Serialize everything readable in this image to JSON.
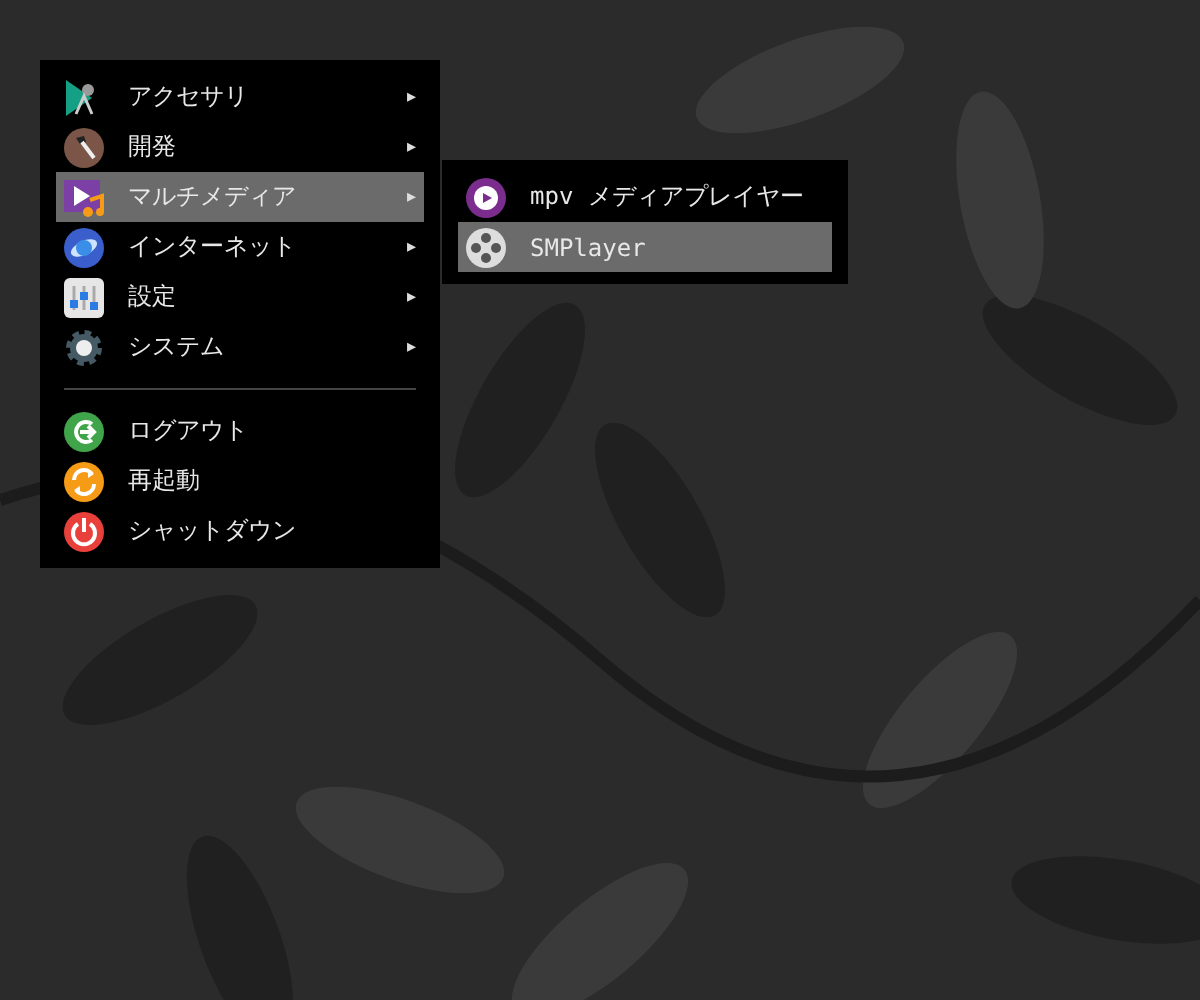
{
  "main_menu": {
    "items": [
      {
        "kind": "item",
        "label": "アクセサリ",
        "arrow": "▸",
        "selected": false
      },
      {
        "kind": "item",
        "label": "開発",
        "arrow": "▸",
        "selected": false
      },
      {
        "kind": "item",
        "label": "マルチメディア",
        "arrow": "▸",
        "selected": true
      },
      {
        "kind": "item",
        "label": "インターネット",
        "arrow": "▸",
        "selected": false
      },
      {
        "kind": "item",
        "label": "設定",
        "arrow": "▸",
        "selected": false
      },
      {
        "kind": "item",
        "label": "システム",
        "arrow": "▸",
        "selected": false
      },
      {
        "kind": "separator"
      },
      {
        "kind": "item",
        "label": "ログアウト",
        "selected": false
      },
      {
        "kind": "item",
        "label": "再起動",
        "selected": false
      },
      {
        "kind": "item",
        "label": "シャットダウン",
        "selected": false
      }
    ]
  },
  "submenu": {
    "items": [
      {
        "label": "mpv メディアプレイヤー",
        "selected": false
      },
      {
        "label": "SMPlayer",
        "selected": true
      }
    ]
  }
}
